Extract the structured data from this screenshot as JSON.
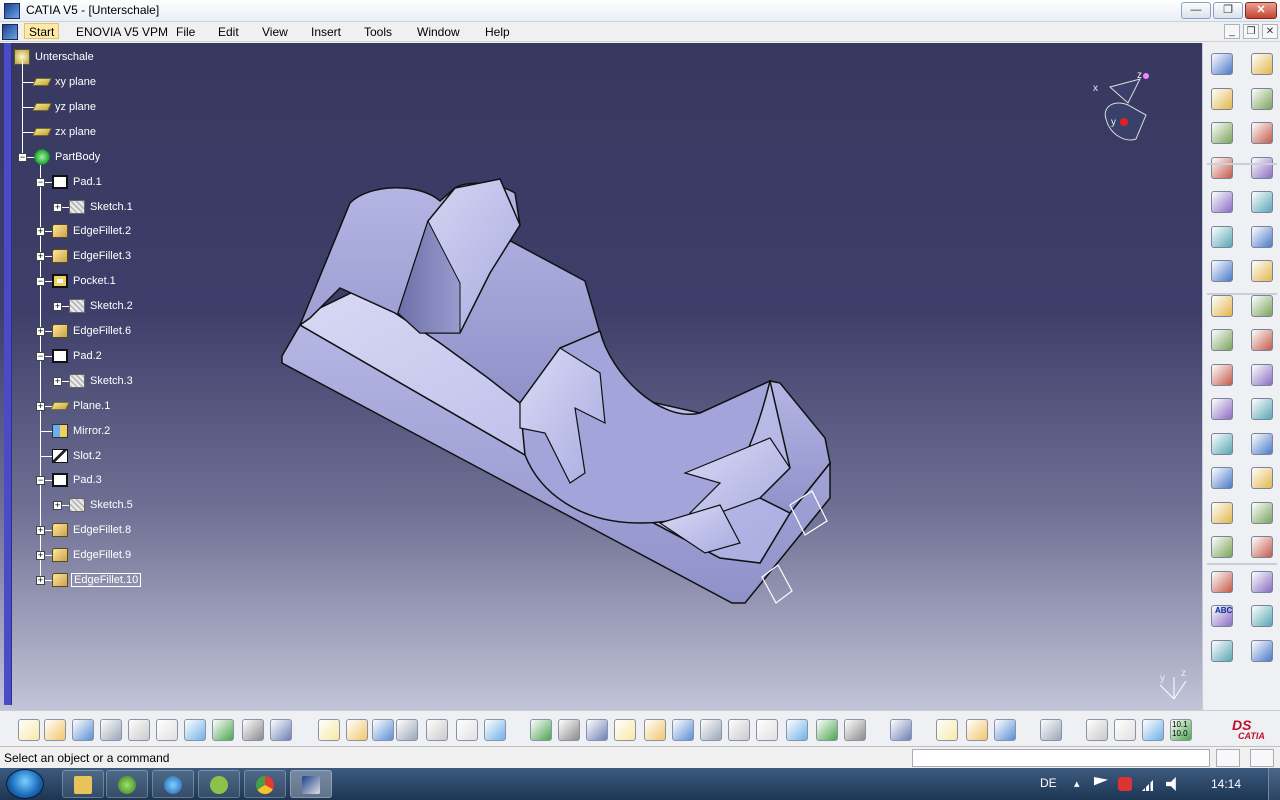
{
  "window": {
    "title": "CATIA V5 - [Unterschale]",
    "min_glyph": "—",
    "max_glyph": "❐",
    "close_glyph": "✕"
  },
  "menu": {
    "items": [
      "Start",
      "ENOVIA V5 VPM",
      "File",
      "Edit",
      "View",
      "Insert",
      "Tools",
      "Window",
      "Help"
    ]
  },
  "tree": {
    "root": "Unterschale",
    "nodes": [
      {
        "label": "xy plane",
        "icon": "plane-icon"
      },
      {
        "label": "yz plane",
        "icon": "plane-icon"
      },
      {
        "label": "zx plane",
        "icon": "plane-icon"
      },
      {
        "label": "PartBody",
        "icon": "partbody-icon"
      },
      {
        "label": "Pad.1",
        "icon": "pad-icon"
      },
      {
        "label": "Sketch.1",
        "icon": "sketch-icon"
      },
      {
        "label": "EdgeFillet.2",
        "icon": "edge-fillet-icon"
      },
      {
        "label": "EdgeFillet.3",
        "icon": "edge-fillet-icon"
      },
      {
        "label": "Pocket.1",
        "icon": "pocket-icon"
      },
      {
        "label": "Sketch.2",
        "icon": "sketch-icon"
      },
      {
        "label": "EdgeFillet.6",
        "icon": "edge-fillet-icon"
      },
      {
        "label": "Pad.2",
        "icon": "pad-icon"
      },
      {
        "label": "Sketch.3",
        "icon": "sketch-icon"
      },
      {
        "label": "Plane.1",
        "icon": "plane-icon"
      },
      {
        "label": "Mirror.2",
        "icon": "mirror-icon"
      },
      {
        "label": "Slot.2",
        "icon": "slot-icon"
      },
      {
        "label": "Pad.3",
        "icon": "pad-icon"
      },
      {
        "label": "Sketch.5",
        "icon": "sketch-icon"
      },
      {
        "label": "EdgeFillet.8",
        "icon": "edge-fillet-icon"
      },
      {
        "label": "EdgeFillet.9",
        "icon": "edge-fillet-icon"
      },
      {
        "label": "EdgeFillet.10",
        "icon": "edge-fillet-icon"
      }
    ]
  },
  "compass": {
    "x": "x",
    "y": "y",
    "z": "z"
  },
  "mini_axis": {
    "y": "y",
    "z": "z"
  },
  "status": {
    "message": "Select an object or a command",
    "command_placeholder": ""
  },
  "toolbar_labels": {
    "catia_logo": "CATIA",
    "abc": "ABC",
    "scale_readout": "10.1\n10.0"
  },
  "taskbar": {
    "language": "DE",
    "clock": "14:14"
  },
  "colors": {
    "viewport_top": "#38385f",
    "viewport_bottom": "#c2c4d8",
    "part_fill": "#b8b9e8",
    "tree_text": "#ffffff",
    "compass_red": "#e02020"
  }
}
